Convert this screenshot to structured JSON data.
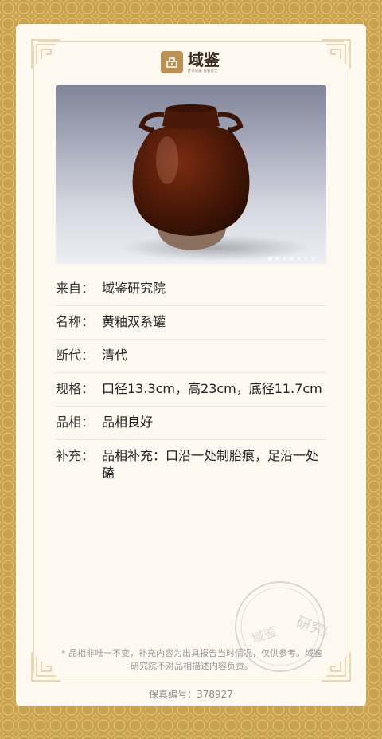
{
  "brand": {
    "name": "域鉴",
    "tagline": "传承收藏 智能鉴定"
  },
  "carousel": {
    "count": 7,
    "active_index": 0
  },
  "fields": [
    {
      "label": "来自：",
      "value": "域鉴研究院"
    },
    {
      "label": "名称：",
      "value": "黄釉双系罐"
    },
    {
      "label": "断代：",
      "value": "清代"
    },
    {
      "label": "规格：",
      "value": " 口径13.3cm，高23cm，底径11.7cm"
    },
    {
      "label": "品相：",
      "value": " 品相良好"
    },
    {
      "label": "补充：",
      "value": "品相补充：口沿一处制胎痕，足沿一处磕"
    }
  ],
  "disclaimer": "* 品相非唯一不变，补充内容为出具报告当时情况，仅供参考。域鉴研究院不对品相描述内容负责。",
  "serial": "保真编号：378927",
  "stamp_text": "研究院",
  "stamp_outer_text": "域鉴",
  "colors": {
    "gold_bg": "#c9a24e",
    "card_bg": "#fdf9f0",
    "frame": "#e9d7ae",
    "brand": "#b89153"
  }
}
